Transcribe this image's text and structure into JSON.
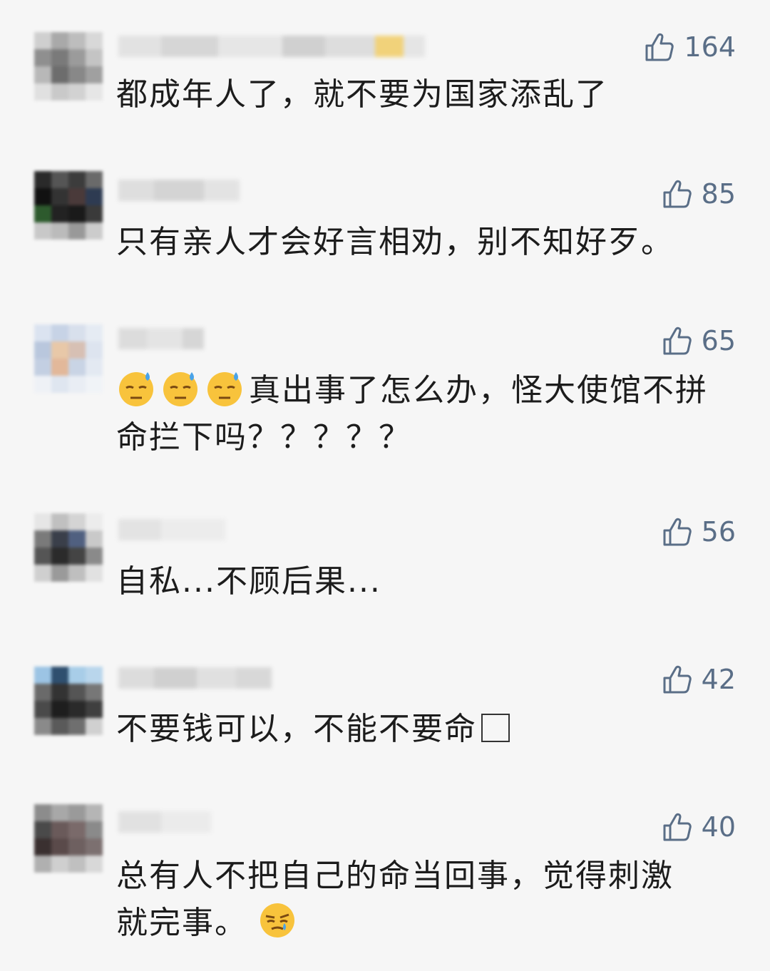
{
  "comments": [
    {
      "likes": "164",
      "text": "都成年人了，就不要为国家添乱了"
    },
    {
      "likes": "85",
      "text": "只有亲人才会好言相劝，别不知好歹。"
    },
    {
      "likes": "65",
      "emoji_prefix": [
        "sweat-face-emoji",
        "sweat-face-emoji",
        "sweat-face-emoji"
      ],
      "text": "真出事了怎么办，怪大使馆不拼",
      "text_line2": "命拦下吗？？？？？"
    },
    {
      "likes": "56",
      "text": "自私...不顾后果..."
    },
    {
      "likes": "42",
      "text": "不要钱可以，不能不要命",
      "trailing": "missing-glyph-box"
    },
    {
      "likes": "40",
      "text": "总有人不把自己的命当回事，觉得刺激",
      "text_line2": "就完事。",
      "emoji_suffix": "smirk-sweat-face-emoji"
    }
  ],
  "colors": {
    "background": "#f6f6f6",
    "like": "#5a6e87",
    "text": "#1c1c1c"
  }
}
